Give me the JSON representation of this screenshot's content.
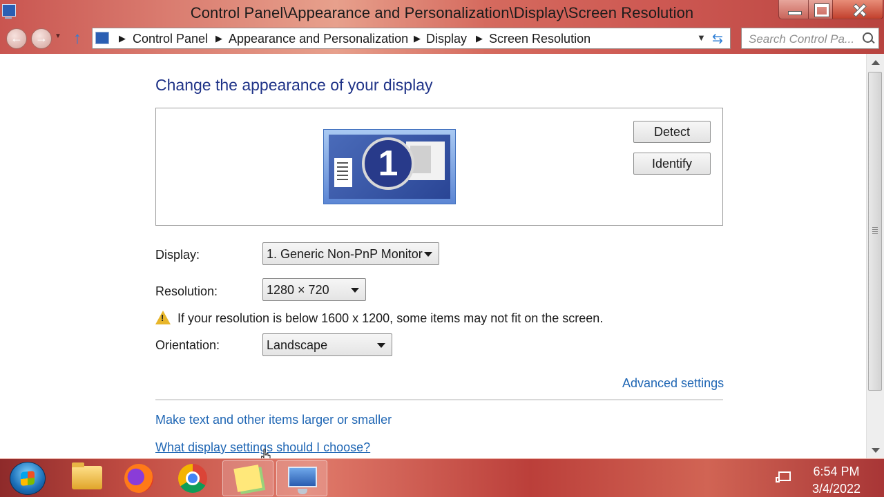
{
  "window": {
    "title": "Control Panel\\Appearance and Personalization\\Display\\Screen Resolution"
  },
  "nav": {
    "back_icon": "back-arrow-icon",
    "forward_icon": "forward-arrow-icon",
    "up_icon": "up-arrow-icon"
  },
  "address": {
    "crumbs": [
      "Control Panel",
      "Appearance and Personalization",
      "Display",
      "Screen Resolution"
    ]
  },
  "search": {
    "placeholder": "Search Control Pa..."
  },
  "main": {
    "heading": "Change the appearance of your display",
    "monitor_number": "1",
    "detect_label": "Detect",
    "identify_label": "Identify",
    "display_label": "Display:",
    "display_value": "1. Generic Non-PnP Monitor",
    "resolution_label": "Resolution:",
    "resolution_value": "1280 × 720",
    "warning_text": "If your resolution is below 1600 x 1200, some items may not fit on the screen.",
    "orientation_label": "Orientation:",
    "orientation_value": "Landscape",
    "advanced_link": "Advanced settings",
    "larger_link": "Make text and other items larger or smaller",
    "choose_link": "What display settings should I choose?"
  },
  "taskbar": {
    "apps": [
      "start-orb",
      "file-explorer-icon",
      "firefox-icon",
      "chrome-icon",
      "sticky-notes-icon",
      "display-settings-icon"
    ],
    "time": "6:54 PM",
    "date": "3/4/2022"
  },
  "colors": {
    "heading": "#1e3287",
    "link": "#1f66b4",
    "chrome_accent": "#c95550"
  }
}
